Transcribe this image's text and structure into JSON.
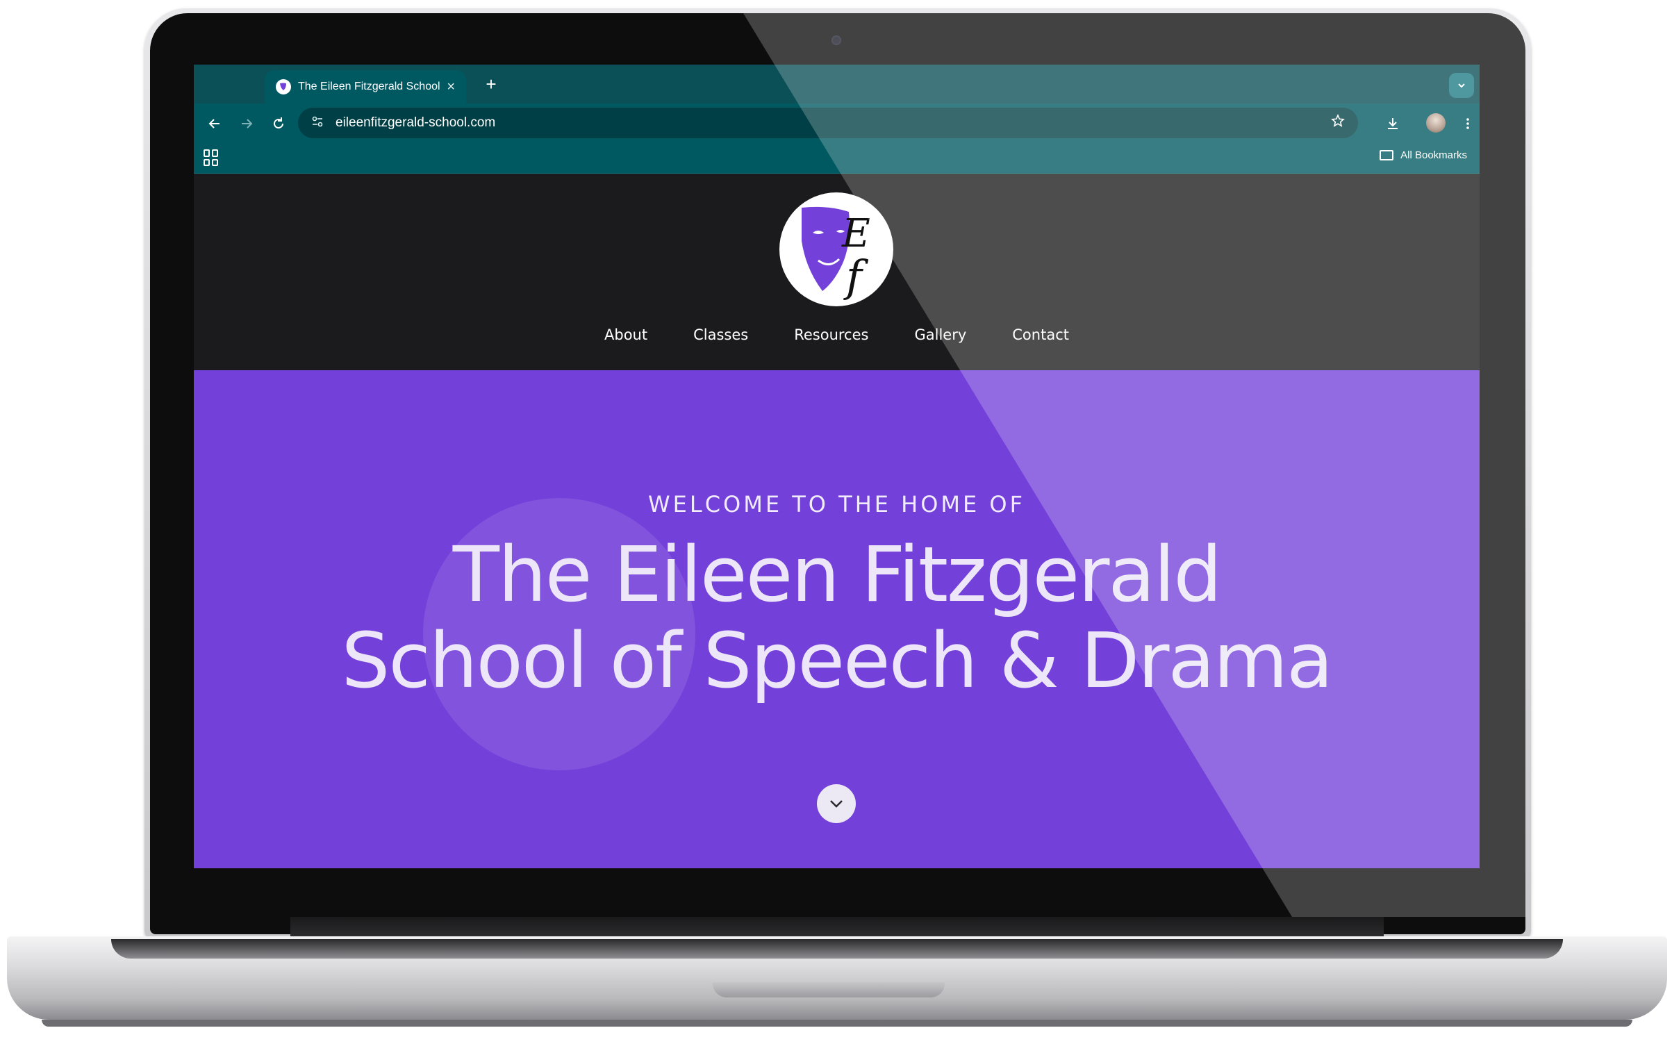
{
  "browser": {
    "tab_title": "The Eileen Fitzgerald School",
    "tab_close_glyph": "×",
    "new_tab_glyph": "+",
    "url": "eileenfitzgerald-school.com",
    "bookmarks_label": "All Bookmarks"
  },
  "site": {
    "logo_letters": [
      "E",
      "f"
    ],
    "nav": [
      "About",
      "Classes",
      "Resources",
      "Gallery",
      "Contact"
    ],
    "hero": {
      "eyebrow": "WELCOME TO THE HOME OF",
      "title_line1": "The Eileen Fitzgerald",
      "title_line2": "School of Speech & Drama"
    }
  },
  "colors": {
    "chrome_accent": "#005961",
    "hero_purple": "#7440da",
    "header_dark": "#1b1b1d"
  },
  "icons": {
    "back": "arrow-left-icon",
    "forward": "arrow-right-icon",
    "reload": "reload-icon",
    "site_info": "tune-icon",
    "bookmark": "star-icon",
    "download": "download-icon",
    "menu": "kebab-menu-icon",
    "apps": "apps-grid-icon",
    "folder": "folder-icon",
    "scroll_down": "chevron-down-icon"
  }
}
